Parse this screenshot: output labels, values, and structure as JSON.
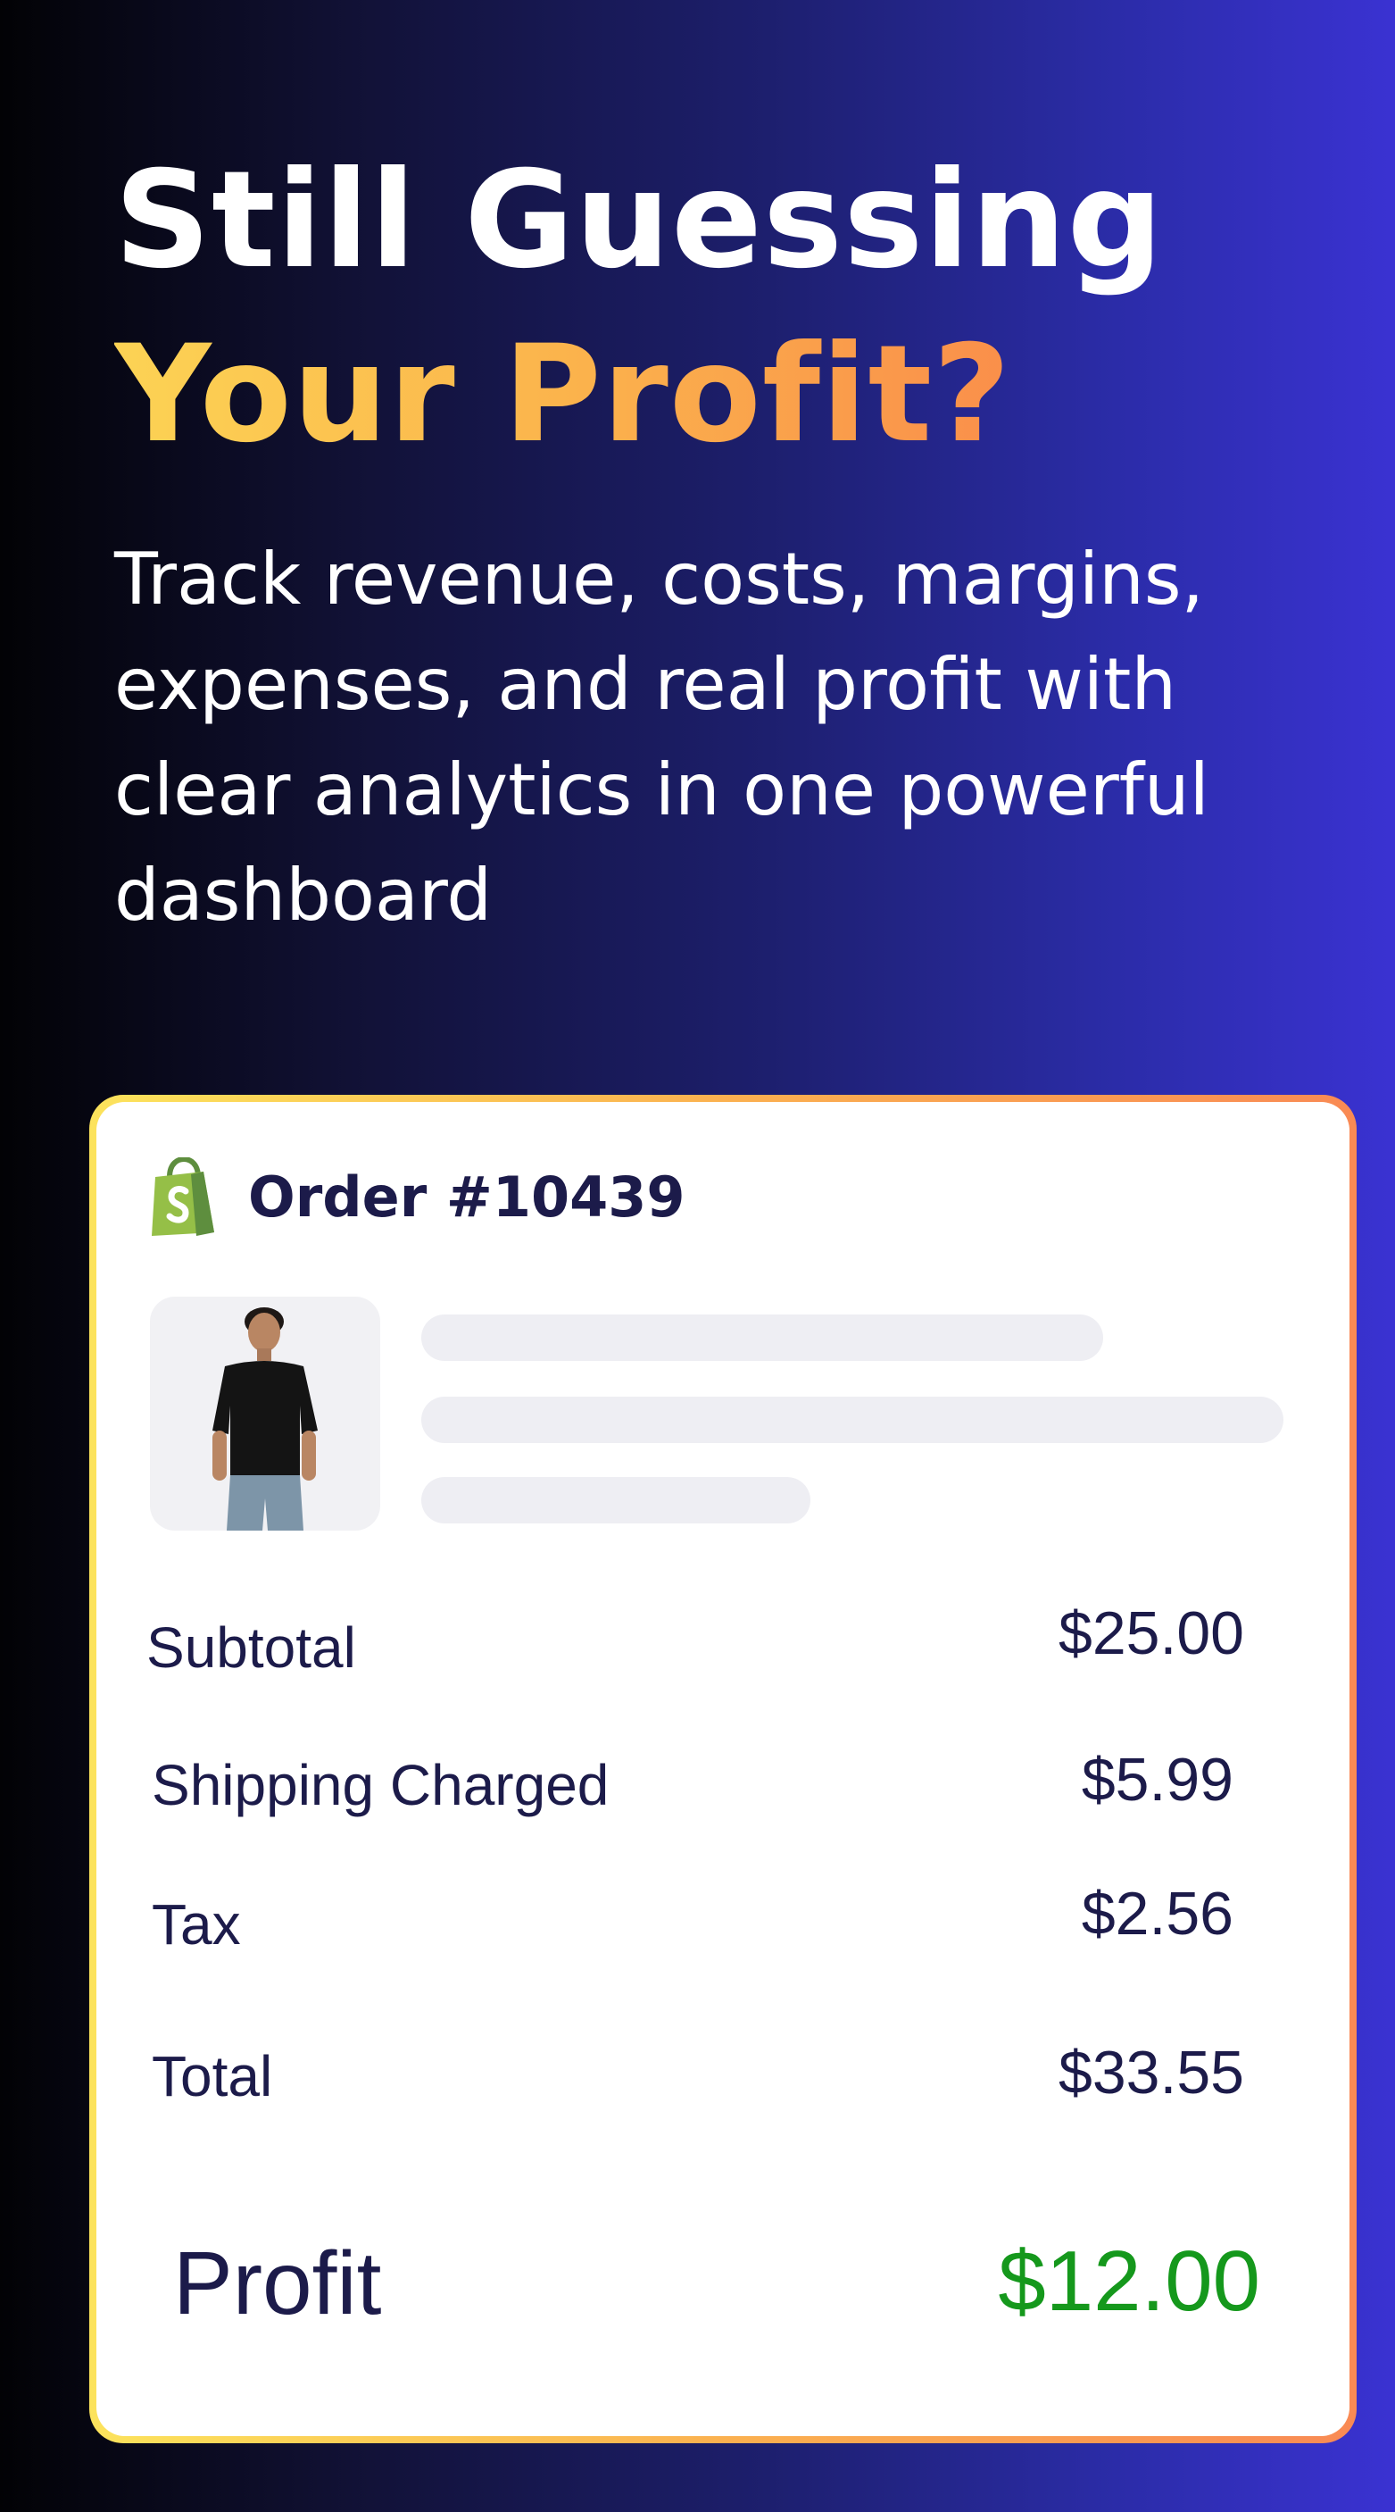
{
  "hero": {
    "title_line1": "Still Guessing",
    "title_line2": "Your Profit?",
    "subtitle": "Track revenue, costs, margins, expenses, and real profit with clear analytics in one powerful dashboard"
  },
  "order_card": {
    "icon": "shopify-bag-icon",
    "title": "Order #10439",
    "product_image": "man-in-black-tshirt",
    "rows": [
      {
        "label": "Subtotal",
        "value": "$25.00"
      },
      {
        "label": "Shipping Charged",
        "value": "$5.99"
      },
      {
        "label": "Tax",
        "value": "$2.56"
      },
      {
        "label": "Total",
        "value": "$33.55"
      }
    ],
    "profit": {
      "label": "Profit",
      "value": "$12.00"
    }
  },
  "colors": {
    "profit_green": "#15981c",
    "text_navy": "#1c1b4a",
    "shopify_green": "#95bf47",
    "headline_accent_start": "#fcd354",
    "headline_accent_end": "#f9824a"
  }
}
